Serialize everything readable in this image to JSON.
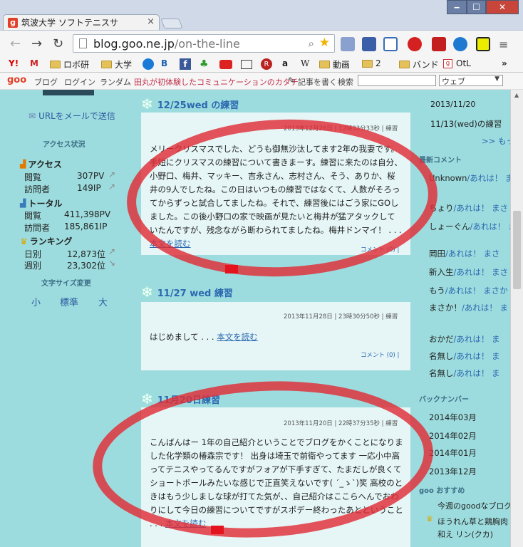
{
  "browser": {
    "tab_title": "筑波大学 ソフトテニスサ",
    "url_host": "blog.goo.ne.jp",
    "url_path": "/on-the-line",
    "bookmarks": [
      "ロボ研",
      "大学",
      "動画",
      "2",
      "バンド",
      "OtL"
    ],
    "bookmark_icon_labels": [
      "W",
      "a"
    ],
    "more_label": "»",
    "minimize": "‒",
    "maximize": "☐",
    "close": "✕"
  },
  "goo_bar": {
    "logo": "goo",
    "links": [
      "ブログ",
      "ログイン",
      "ランダム"
    ],
    "promo": "田丸が初体験したコミュニケーションのカタチ",
    "write": "記事を書く",
    "search_label": "検索",
    "search_select": "ウェブ"
  },
  "left_sidebar": {
    "top_partial": "........",
    "url_mail": "URLをメールで送信",
    "access_heading": "アクセス状況",
    "access_title": "アクセス",
    "access_rows": [
      {
        "label": "閲覧",
        "value": "307PV"
      },
      {
        "label": "訪問者",
        "value": "149IP"
      }
    ],
    "total_title": "トータル",
    "total_rows": [
      {
        "label": "閲覧",
        "value": "411,398PV"
      },
      {
        "label": "訪問者",
        "value": "185,861IP"
      }
    ],
    "ranking_title": "ランキング",
    "ranking_rows": [
      {
        "label": "日別",
        "value": "12,873位"
      },
      {
        "label": "週別",
        "value": "23,302位"
      }
    ],
    "fontsize_heading": "文字サイズ変更",
    "fontsize_options": [
      "小",
      "標準",
      "大"
    ]
  },
  "posts": [
    {
      "title": "12/25wed の練習",
      "meta": "2013年12月26日 | 12時33分33秒 | 練習",
      "body": "メリークリスマスでした、どうも御無沙汰してます2年の我妻です。手短にクリスマスの練習について書きまーす。練習に来たのは自分、小野口、梅井、マッキー、吉永さん、志村さん、そう、ありか、桜井の9人でしたね。この日はいつもの練習ではなくて、人数がそろってからずっと試合してましたね。それで、練習後にはごう家にGOしました。この後小野口の家で映画が見たいと梅井が猛アタックしていたんですが、残念ながら断わられてましたね。梅井ドンマイ！ . . . ",
      "read_more": "本文を読む",
      "comment": "コメント (0) |"
    },
    {
      "title": "11/27 wed 練習",
      "meta": "2013年11月28日 | 23時30分50秒 | 練習",
      "body": "はじめまして . . . ",
      "read_more": "本文を読む",
      "comment": "コメント (0) |"
    },
    {
      "title": "11月20日練習",
      "meta": "2013年11月20日 | 22時37分35秒 | 練習",
      "body": "こんばんはー 1年の自己紹介ということでブログをかくことになりました化学類の椿森宗です！ 出身は埼玉で前衛やってます 一応小中高ってテニスやってるんですがフォアが下手すぎて、たまだしが良くてショートボールみたいな感じで正直笑えないです( ´_ゝ`)笑 高校のときはもう少しましな球が打てた気が、、自己紹介はここらへんでおわりにして今日の練習についてですがスポデー終わったあとということ . . . ",
      "read_more": "本文を読む",
      "comment": ""
    }
  ],
  "right_sidebar": {
    "top_date": "2013/11/20",
    "top_post": "11/13(wed)の練習",
    "more": ">> もっ",
    "comments_heading": "最新コメント",
    "comments": [
      {
        "name": "Unknown",
        "text": "/あれは！ まさか！"
      },
      {
        "name": "ちょり",
        "text": "/あれは！ まさ"
      },
      {
        "name": "しょーぐん",
        "text": "/あれは！ ま"
      },
      {
        "name": "岡田",
        "text": "/あれは！ まさ"
      },
      {
        "name": "新入生",
        "text": "/あれは！ まさ"
      },
      {
        "name": "もう",
        "text": "/あれは！ まさか"
      },
      {
        "name": "まさか！",
        "text": "/あれは！ ま"
      },
      {
        "name": "おかだ",
        "text": "/あれは！ ま"
      },
      {
        "name": "名無し",
        "text": "/あれは！ ま"
      },
      {
        "name": "名無し",
        "text": "/あれは！ ま"
      }
    ],
    "backnumber_heading": "バックナンバー",
    "backnumbers": [
      "2014年03月",
      "2014年02月",
      "2014年01月",
      "2013年12月"
    ],
    "recommend_heading": "goo おすすめ",
    "recommend_items": [
      "今週のgoodなブログ",
      "ほうれん草と鶏胸肉",
      "和え リン(クカ)"
    ]
  }
}
